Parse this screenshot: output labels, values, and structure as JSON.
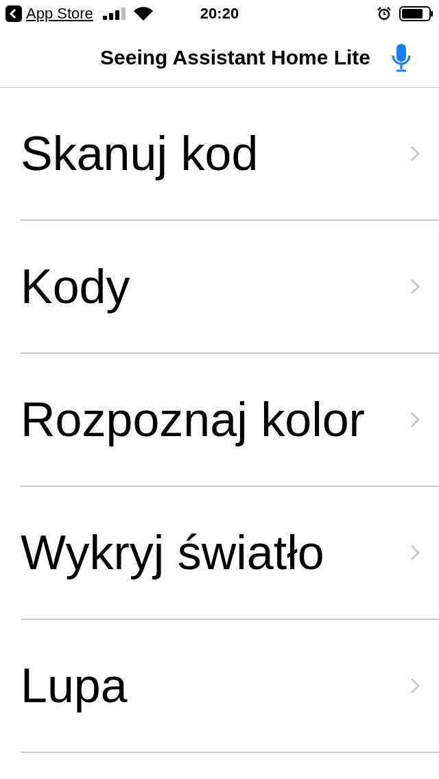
{
  "status_bar": {
    "back_label": "App Store",
    "time": "20:20"
  },
  "nav_bar": {
    "title": "Seeing Assistant Home Lite"
  },
  "menu": [
    {
      "label": "Skanuj kod"
    },
    {
      "label": "Kody"
    },
    {
      "label": "Rozpoznaj kolor"
    },
    {
      "label": "Wykryj światło"
    },
    {
      "label": "Lupa"
    }
  ]
}
